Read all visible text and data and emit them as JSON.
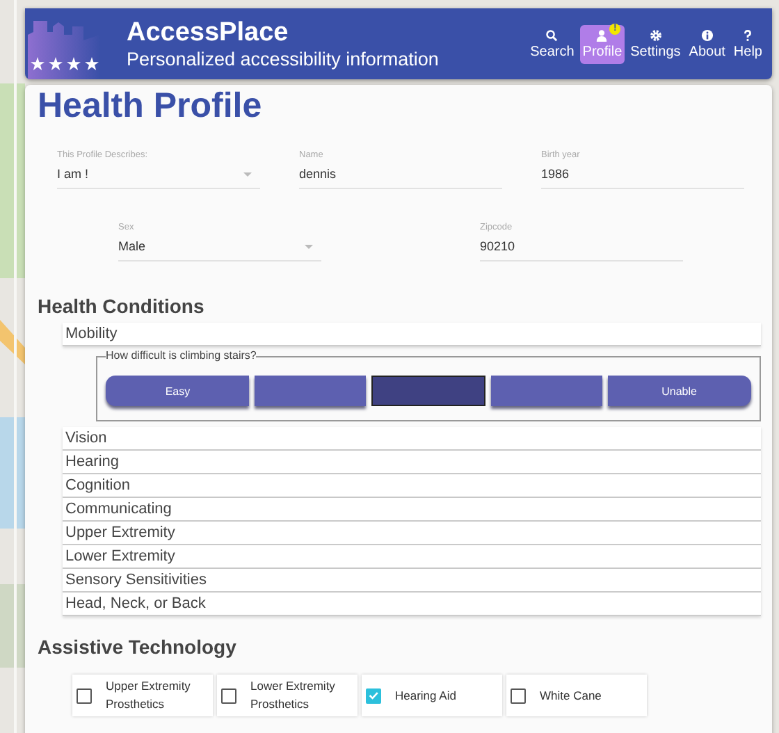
{
  "header": {
    "title": "AccessPlace",
    "subtitle": "Personalized accessibility information",
    "nav": [
      {
        "kind": "search",
        "label": "Search",
        "selected": false,
        "has_alert": false
      },
      {
        "kind": "profile",
        "label": "Profile",
        "selected": true,
        "has_alert": true,
        "alert": "!"
      },
      {
        "kind": "settings",
        "label": "Settings",
        "selected": false,
        "has_alert": false
      },
      {
        "kind": "about",
        "label": "About",
        "selected": false,
        "has_alert": false
      },
      {
        "kind": "help",
        "label": "Help",
        "selected": false,
        "has_alert": false
      }
    ]
  },
  "page_title": "Health Profile",
  "fields_row_1": [
    {
      "kind": "select",
      "label": "This Profile Describes:",
      "value": "I am !"
    },
    {
      "kind": "text",
      "label": "Name",
      "value": "dennis"
    },
    {
      "kind": "text",
      "label": "Birth year",
      "value": "1986"
    }
  ],
  "fields_row_2": [
    {
      "kind": "select",
      "label": "Sex",
      "value": "Male"
    },
    {
      "kind": "text",
      "label": "Zipcode",
      "value": "90210"
    }
  ],
  "conditions_heading": "Health Conditions",
  "conditions": [
    {
      "label": "Mobility",
      "expanded": true,
      "question": "How difficult is climbing stairs?",
      "scale": [
        {
          "label": "Easy",
          "selected": false
        },
        {
          "selected": false
        },
        {
          "selected": true
        },
        {
          "selected": false
        },
        {
          "label": "Unable",
          "selected": false
        }
      ]
    },
    {
      "label": "Vision",
      "expanded": false
    },
    {
      "label": "Hearing",
      "expanded": false
    },
    {
      "label": "Cognition",
      "expanded": false
    },
    {
      "label": "Communicating",
      "expanded": false
    },
    {
      "label": "Upper Extremity",
      "expanded": false
    },
    {
      "label": "Lower Extremity",
      "expanded": false
    },
    {
      "label": "Sensory Sensitivities",
      "expanded": false
    },
    {
      "label": "Head, Neck, or Back",
      "expanded": false
    }
  ],
  "assistive_heading": "Assistive Technology",
  "assistive": [
    {
      "label": "Upper Extremity Prosthetics",
      "checked": false
    },
    {
      "label": "Lower Extremity Prosthetics",
      "checked": false
    },
    {
      "label": "Hearing Aid",
      "checked": true
    },
    {
      "label": "White Cane",
      "checked": false
    }
  ]
}
